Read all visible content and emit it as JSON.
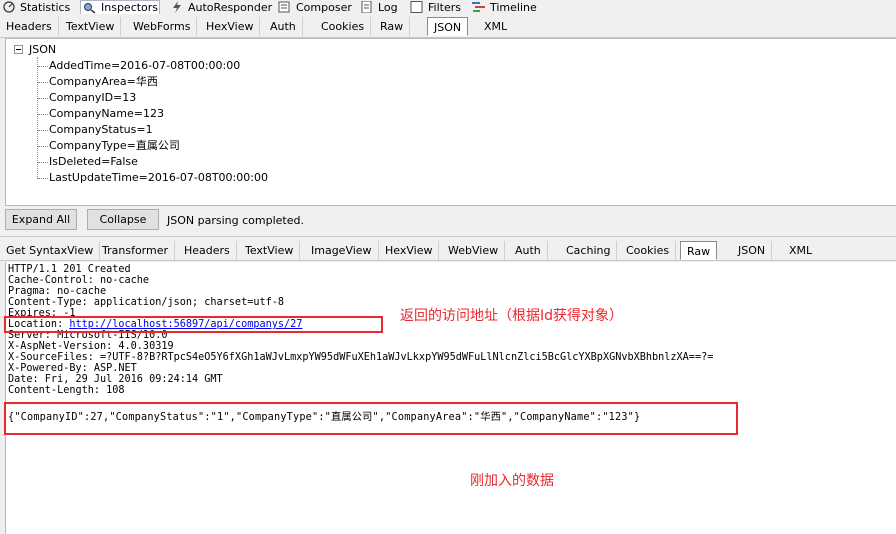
{
  "top_tabs": [
    {
      "label": "Statistics",
      "icon": "statistics-icon"
    },
    {
      "label": "Inspectors",
      "icon": "inspectors-icon"
    },
    {
      "label": "AutoResponder",
      "icon": "lightning-icon"
    },
    {
      "label": "Composer",
      "icon": "composer-icon"
    },
    {
      "label": "Log",
      "icon": "log-icon"
    },
    {
      "label": "Filters",
      "icon": "checkbox-icon"
    },
    {
      "label": "Timeline",
      "icon": "timeline-icon"
    }
  ],
  "request_tabs": [
    "Headers",
    "TextView",
    "WebForms",
    "HexView",
    "Auth",
    "Cookies",
    "Raw",
    "JSON",
    "XML"
  ],
  "request_active_tab": "JSON",
  "tree": {
    "root": "JSON",
    "items": [
      "AddedTime=2016-07-08T00:00:00",
      "CompanyArea=华西",
      "CompanyID=13",
      "CompanyName=123",
      "CompanyStatus=1",
      "CompanyType=直属公司",
      "IsDeleted=False",
      "LastUpdateTime=2016-07-08T00:00:00"
    ]
  },
  "buttons": {
    "expand_all": "Expand All",
    "collapse": "Collapse",
    "status": "JSON parsing completed."
  },
  "response_tabs": [
    "Get SyntaxView",
    "Transformer",
    "Headers",
    "TextView",
    "ImageView",
    "HexView",
    "WebView",
    "Auth",
    "Caching",
    "Cookies",
    "Raw",
    "JSON",
    "XML"
  ],
  "response_active_tab": "Raw",
  "raw": {
    "lines": [
      "HTTP/1.1 201 Created",
      "Cache-Control: no-cache",
      "Pragma: no-cache",
      "Content-Type: application/json; charset=utf-8",
      "Expires: -1"
    ],
    "location_label": "Location: ",
    "location_url": "http://localhost:56897/api/companys/27",
    "lines_after": [
      "Server: Microsoft-IIS/10.0",
      "X-AspNet-Version: 4.0.30319",
      "X-SourceFiles: =?UTF-8?B?RTpcS4eO5Y6fXGh1aWJvLmxpYW95dWFuXEh1aWJvLkxpYW95dWFuLlNlcnZlci5BcGlcYXBpXGNvbXBhbnlzXA==?=",
      "X-Powered-By: ASP.NET",
      "Date: Fri, 29 Jul 2016 09:24:14 GMT",
      "Content-Length: 108"
    ],
    "body": "{\"CompanyID\":27,\"CompanyStatus\":\"1\",\"CompanyType\":\"直属公司\",\"CompanyArea\":\"华西\",\"CompanyName\":\"123\"}"
  },
  "annotations": {
    "location_note": "返回的访问地址（根据Id获得对象）",
    "body_note": "刚加入的数据"
  },
  "colors": {
    "annotation_red": "#e8292f",
    "link_blue": "#0000ee"
  }
}
